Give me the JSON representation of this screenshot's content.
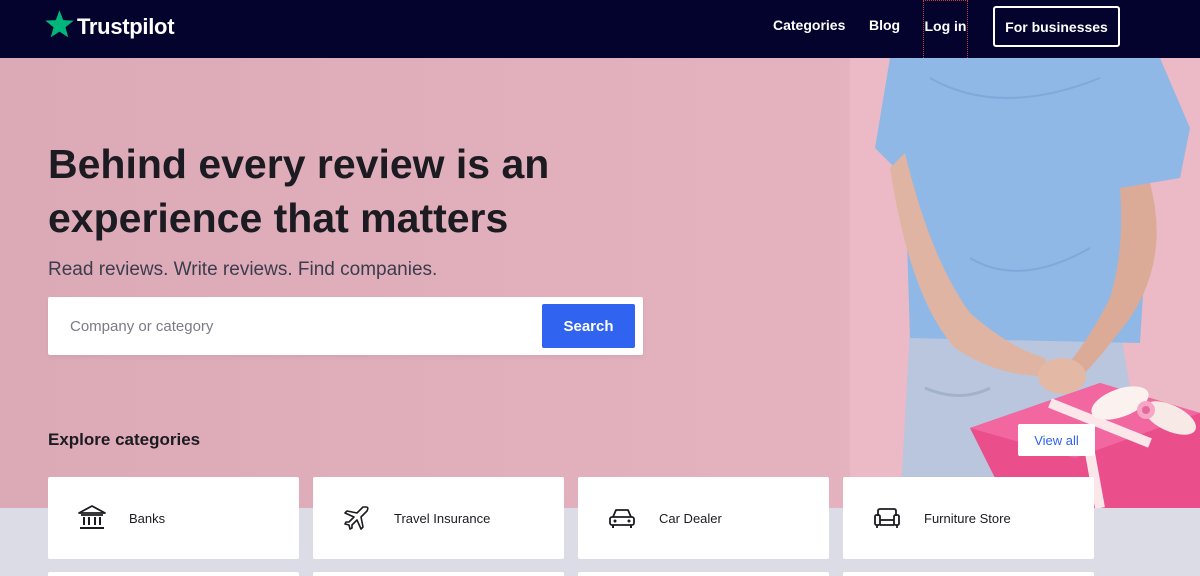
{
  "nav": {
    "brand": "Trustpilot",
    "categories": "Categories",
    "blog": "Blog",
    "login": "Log in",
    "business": "For businesses"
  },
  "hero": {
    "headline_line1": "Behind every review is an",
    "headline_line2": "experience that matters",
    "subheadline": "Read reviews. Write reviews. Find companies."
  },
  "search": {
    "placeholder": "Company or category",
    "button": "Search"
  },
  "explore": {
    "title": "Explore categories",
    "view_all": "View all",
    "categories": [
      {
        "label": "Banks",
        "icon": "bank-icon"
      },
      {
        "label": "Travel Insurance",
        "icon": "airplane-icon"
      },
      {
        "label": "Car Dealer",
        "icon": "car-icon"
      },
      {
        "label": "Furniture Store",
        "icon": "sofa-icon"
      }
    ]
  },
  "colors": {
    "nav_bg": "#04032d",
    "brand_star": "#00b67a",
    "hero_pink": "#e3b1bd",
    "accent_blue": "#2f63f0"
  }
}
